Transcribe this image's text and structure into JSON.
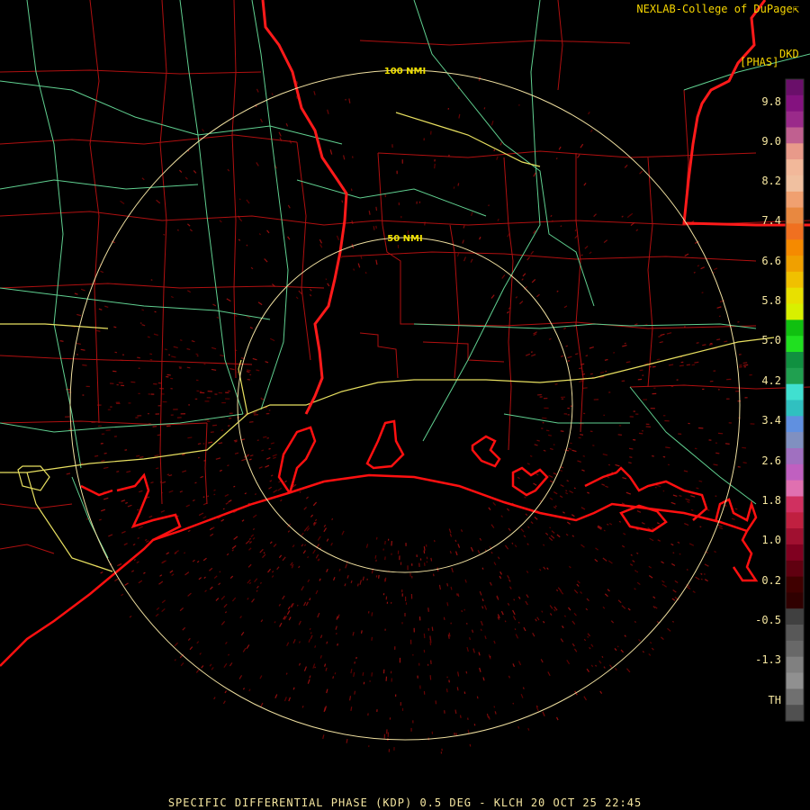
{
  "credit": "NEXLAB-College of DuPage",
  "credit_icon": "cursor-arrow-icon",
  "units": {
    "line1": "DKD",
    "line2": "[PHAS]"
  },
  "rings": [
    {
      "label": "100 NMI",
      "range_nmi": 100
    },
    {
      "label": "50 NMI",
      "range_nmi": 50
    }
  ],
  "legend": {
    "labels": [
      "9.8",
      "9.0",
      "8.2",
      "7.4",
      "6.6",
      "5.8",
      "5.0",
      "4.2",
      "3.4",
      "2.6",
      "1.8",
      "1.0",
      "0.2",
      "-0.5",
      "-1.3",
      "TH"
    ],
    "colors": [
      "#6a0f6a",
      "#84127f",
      "#9a2a8a",
      "#c06090",
      "#e89a8a",
      "#f2b89a",
      "#f0c0a0",
      "#f0a070",
      "#e88840",
      "#f07020",
      "#f58a00",
      "#f0a000",
      "#f0c000",
      "#e8e000",
      "#d8f000",
      "#10c010",
      "#20e020",
      "#109040",
      "#20a050",
      "#40e0d0",
      "#30c0c0",
      "#6090e0",
      "#8090c0",
      "#a070c0",
      "#c060c0",
      "#e070b0",
      "#d03060",
      "#c02040",
      "#a01030",
      "#800020",
      "#600010",
      "#400000",
      "#300000",
      "#404040",
      "#585858",
      "#686868",
      "#808080",
      "#909090",
      "#707070",
      "#505050"
    ]
  },
  "caption": "SPECIFIC DIFFERENTIAL PHASE (KDP) 0.5 DEG - KLCH 20 OCT 25 22:45",
  "colors": {
    "coast": "#ff1010",
    "county": "#b01010",
    "state": "#ff1a1a",
    "highway": "#60d090",
    "interstate": "#e8e060",
    "ring": "#f0e0a0"
  }
}
